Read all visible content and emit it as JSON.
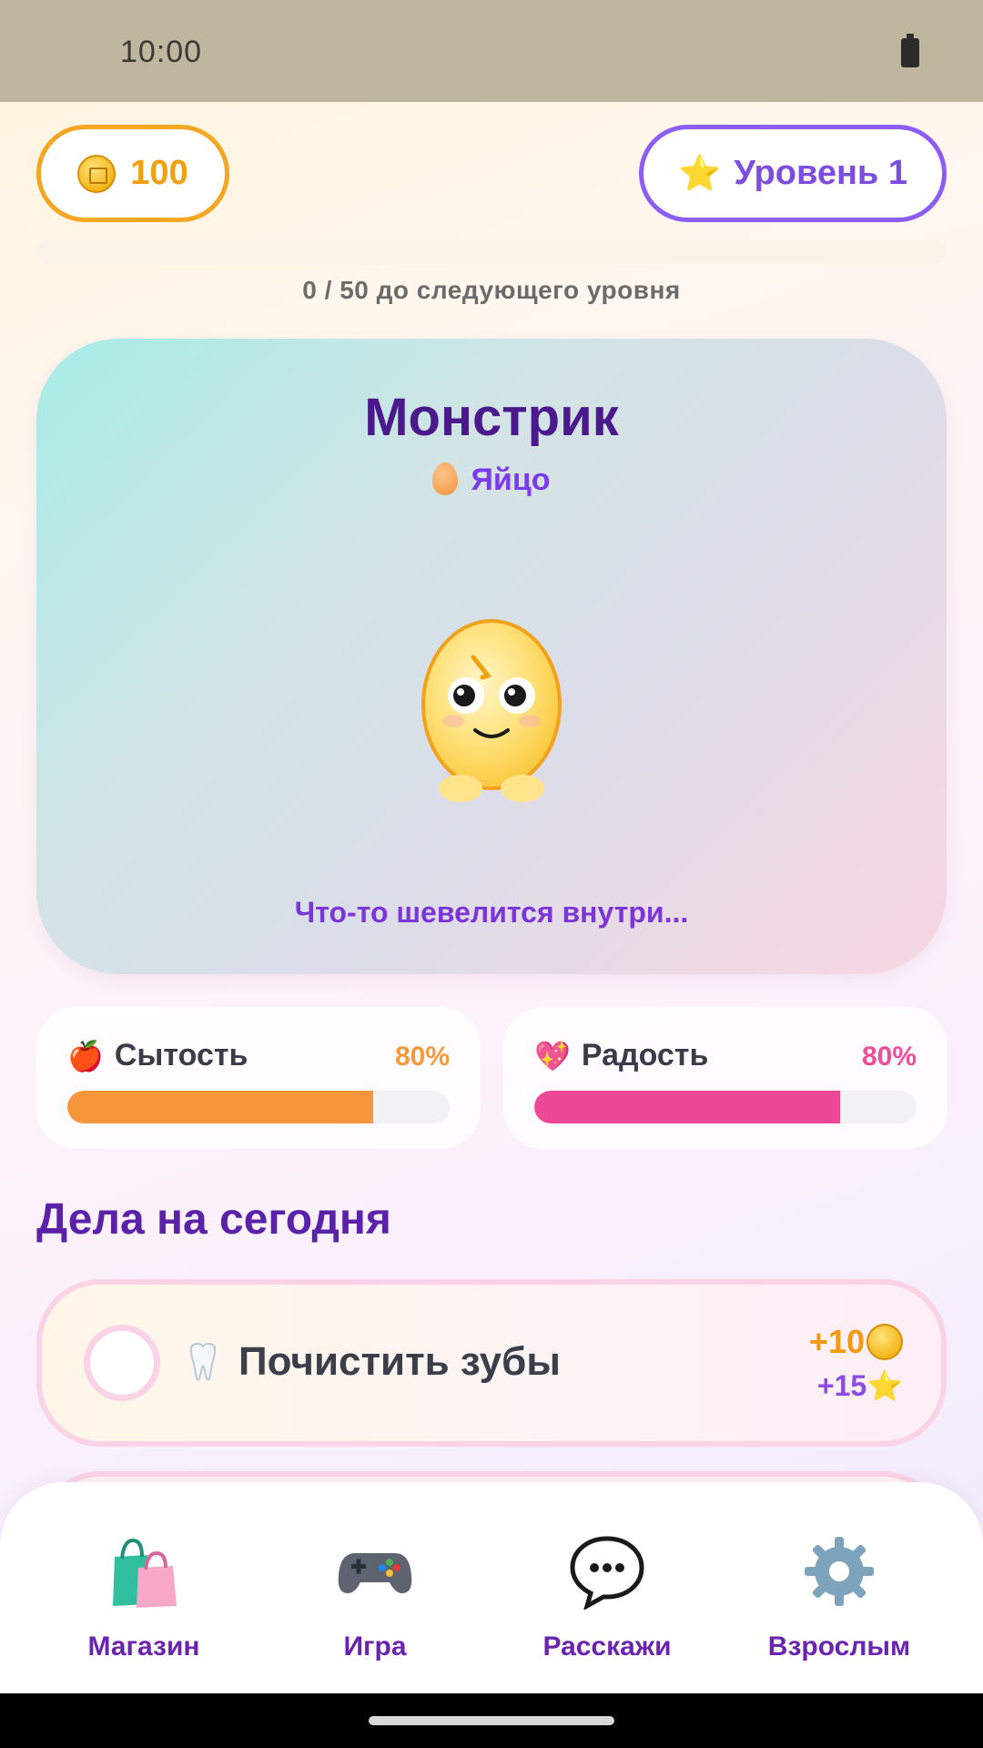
{
  "status_bar": {
    "time": "10:00"
  },
  "header": {
    "coins": "100",
    "level_label": "Уровень 1",
    "xp_text": "0 / 50 до следующего уровня",
    "xp_progress": 0
  },
  "pet": {
    "name": "Монстрик",
    "stage": "Яйцо",
    "mood_text": "Что-то шевелится внутри..."
  },
  "stats": {
    "hunger": {
      "label": "Сытость",
      "value_text": "80%",
      "value": 0.8,
      "icon": "apple-icon"
    },
    "joy": {
      "label": "Радость",
      "value_text": "80%",
      "value": 0.8,
      "icon": "sparkling-heart-icon"
    }
  },
  "tasks": {
    "title": "Дела на сегодня",
    "items": [
      {
        "label": "Почистить зубы",
        "icon": "tooth-icon",
        "coins": "+10",
        "xp": "+15"
      }
    ]
  },
  "nav": {
    "items": [
      {
        "label": "Магазин",
        "icon": "shopping-bags-icon"
      },
      {
        "label": "Игра",
        "icon": "gamepad-icon"
      },
      {
        "label": "Расскажи",
        "icon": "speech-bubble-icon"
      },
      {
        "label": "Взрослым",
        "icon": "gear-icon"
      }
    ]
  },
  "colors": {
    "coin_accent": "#f5a623",
    "level_accent": "#8b5cf6",
    "title_purple": "#4a1a8c",
    "hunger_bar": "#f7953a",
    "joy_bar": "#ec4897"
  }
}
